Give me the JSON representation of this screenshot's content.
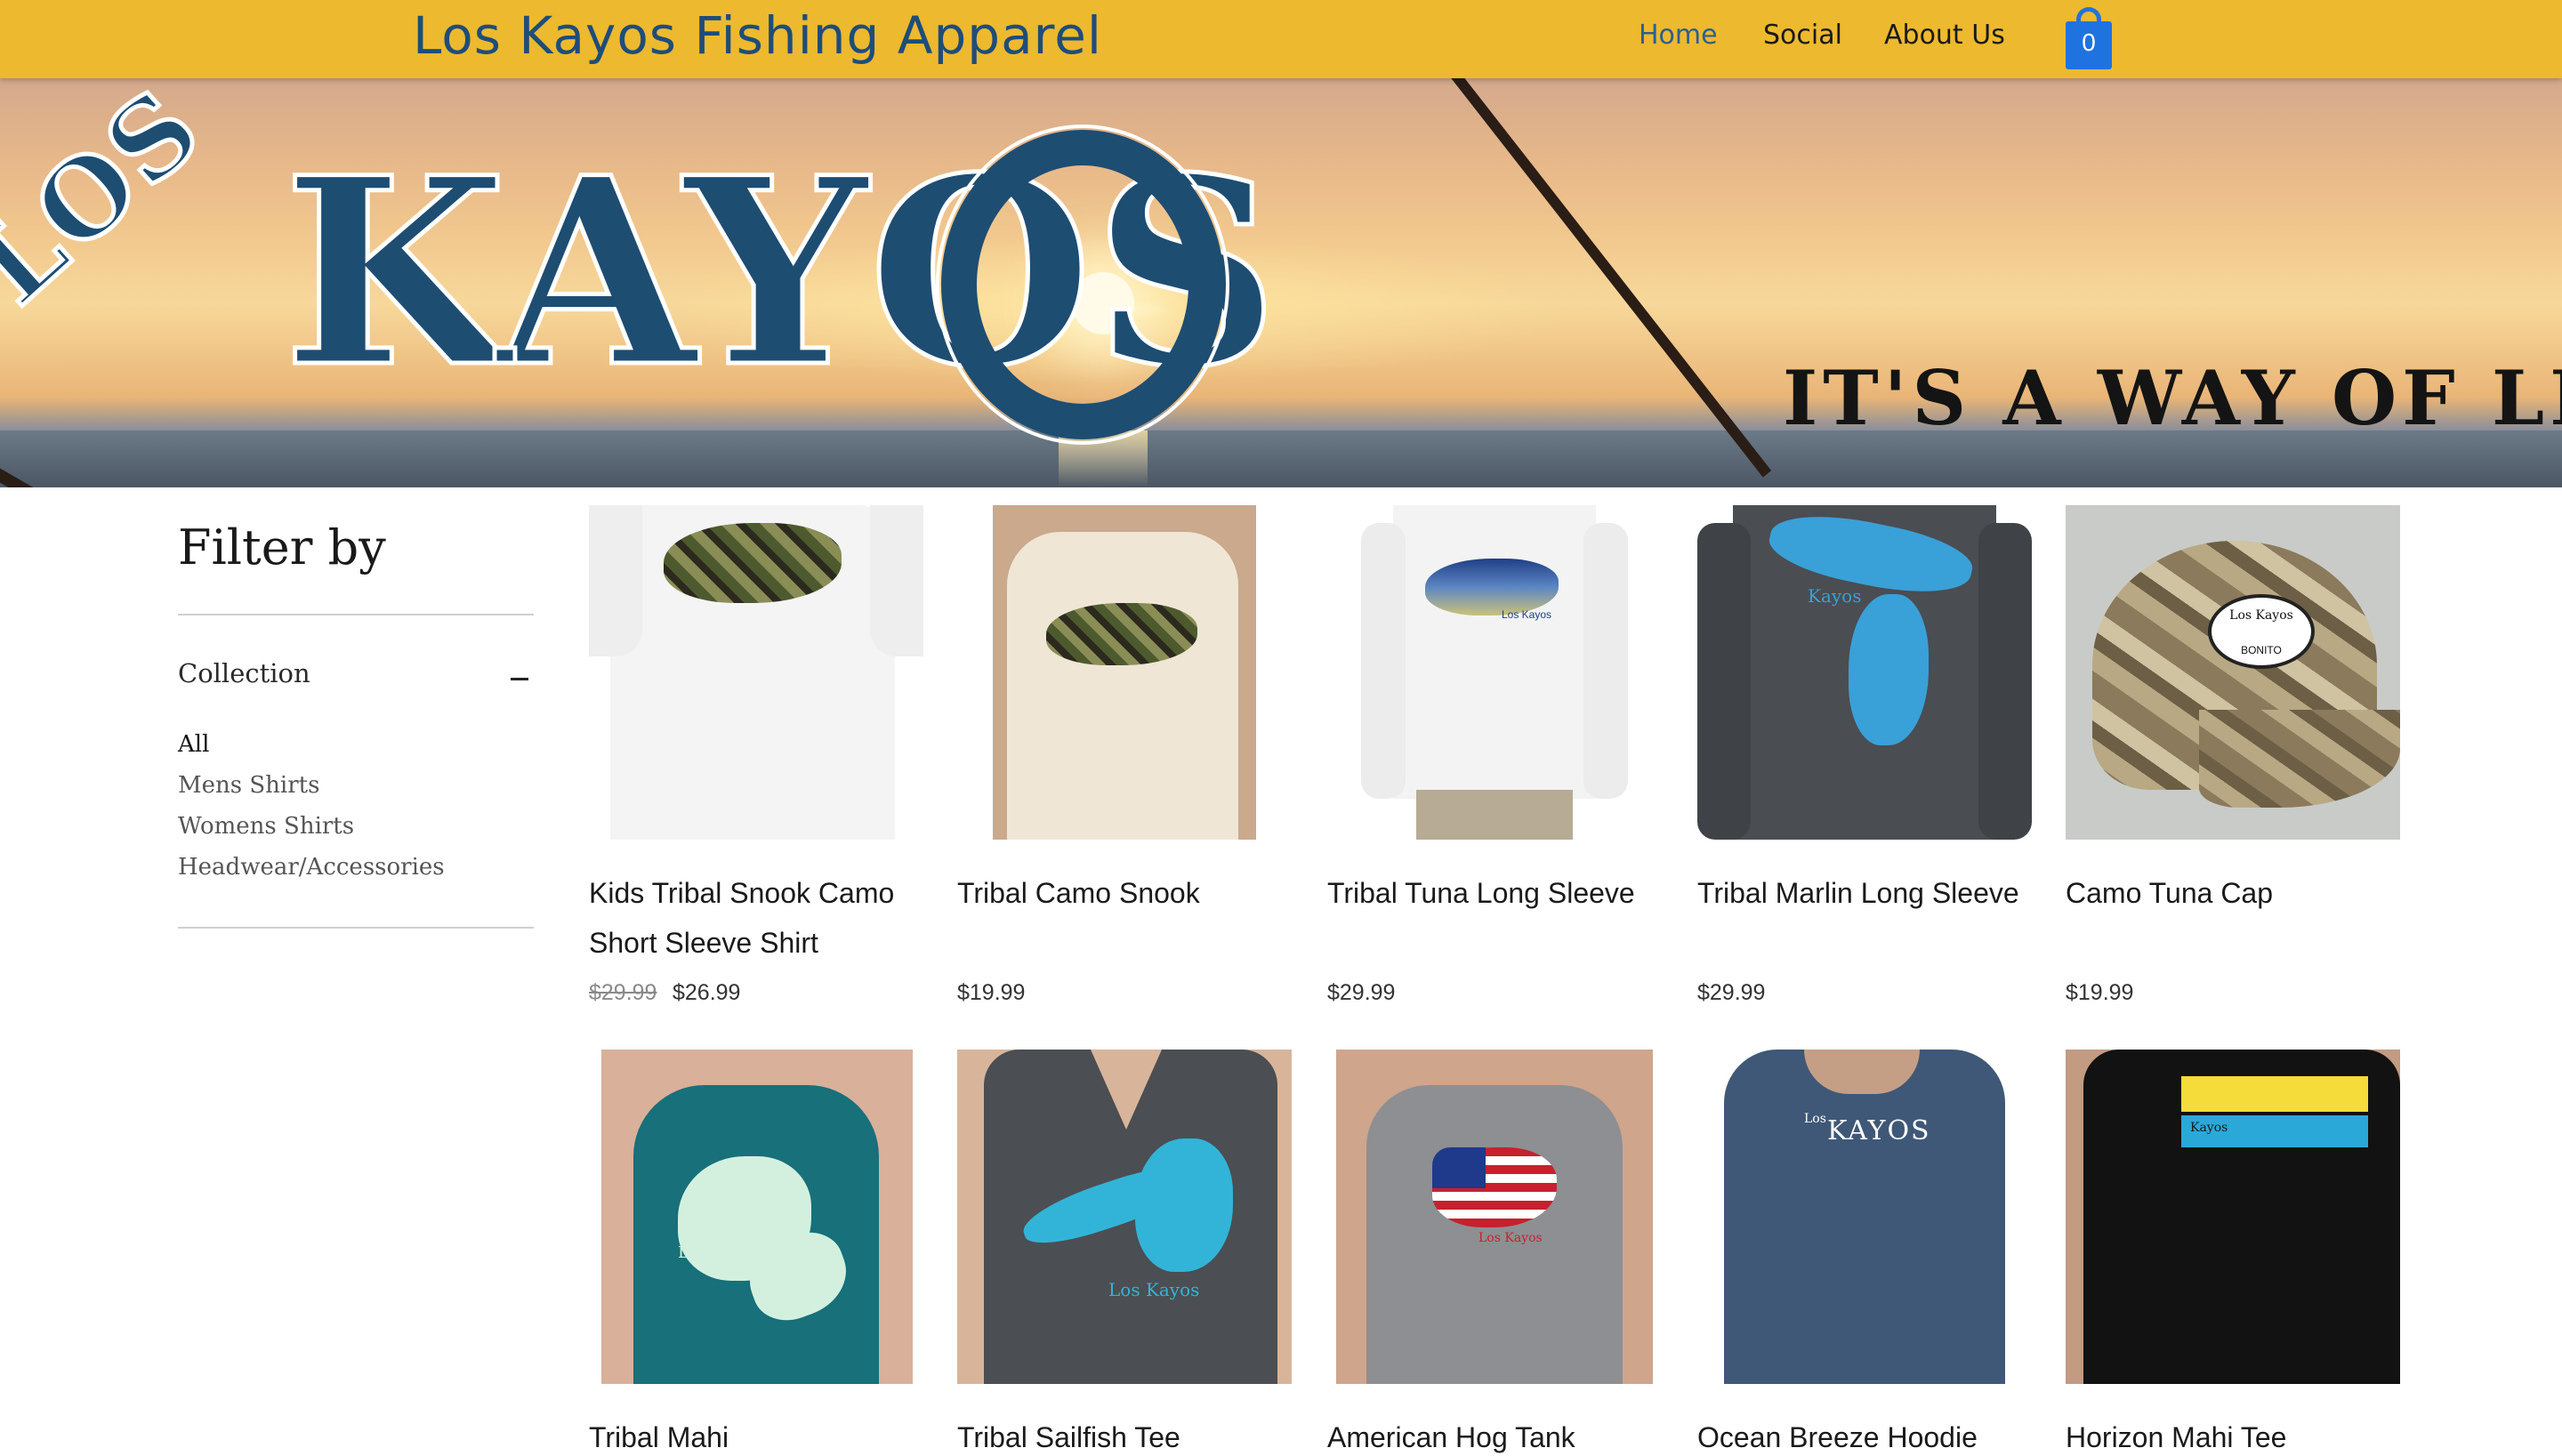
{
  "header": {
    "site_title": "Los Kayos Fishing Apparel",
    "nav": [
      "Home",
      "Social",
      "About Us"
    ],
    "cart_count": "0"
  },
  "banner": {
    "logo_small": "LOS",
    "logo_large": "KAYOS",
    "tagline": "IT'S A WAY OF LIFE"
  },
  "filter": {
    "title": "Filter by",
    "section_label": "Collection",
    "categories": [
      "All",
      "Mens Shirts",
      "Womens Shirts",
      "Headwear/Accessories"
    ]
  },
  "products": [
    {
      "name": "Kids Tribal Snook Camo Short Sleeve Shirt",
      "old_price": "$29.99",
      "price": "$26.99"
    },
    {
      "name": "Tribal Camo Snook",
      "price": "$19.99"
    },
    {
      "name": "Tribal Tuna Long Sleeve",
      "price": "$29.99"
    },
    {
      "name": "Tribal Marlin Long Sleeve",
      "price": "$29.99"
    },
    {
      "name": "Camo Tuna Cap",
      "price": "$19.99"
    },
    {
      "name": "Tribal Mahi"
    },
    {
      "name": "Tribal Sailfish Tee"
    },
    {
      "name": "American Hog Tank"
    },
    {
      "name": "Ocean Breeze Hoodie"
    },
    {
      "name": "Horizon Mahi Tee"
    }
  ],
  "print_text": {
    "kayos": "Kayos",
    "los_kayos": "Los Kayos",
    "los": "Los",
    "kayos_caps": "KAYOS",
    "bonito": "BONITO"
  },
  "colors": {
    "header_bg": "#edb92e",
    "title_blue": "#1e4d7a",
    "cart_blue": "#1f73e0",
    "logo_blue": "#1e4d72"
  }
}
